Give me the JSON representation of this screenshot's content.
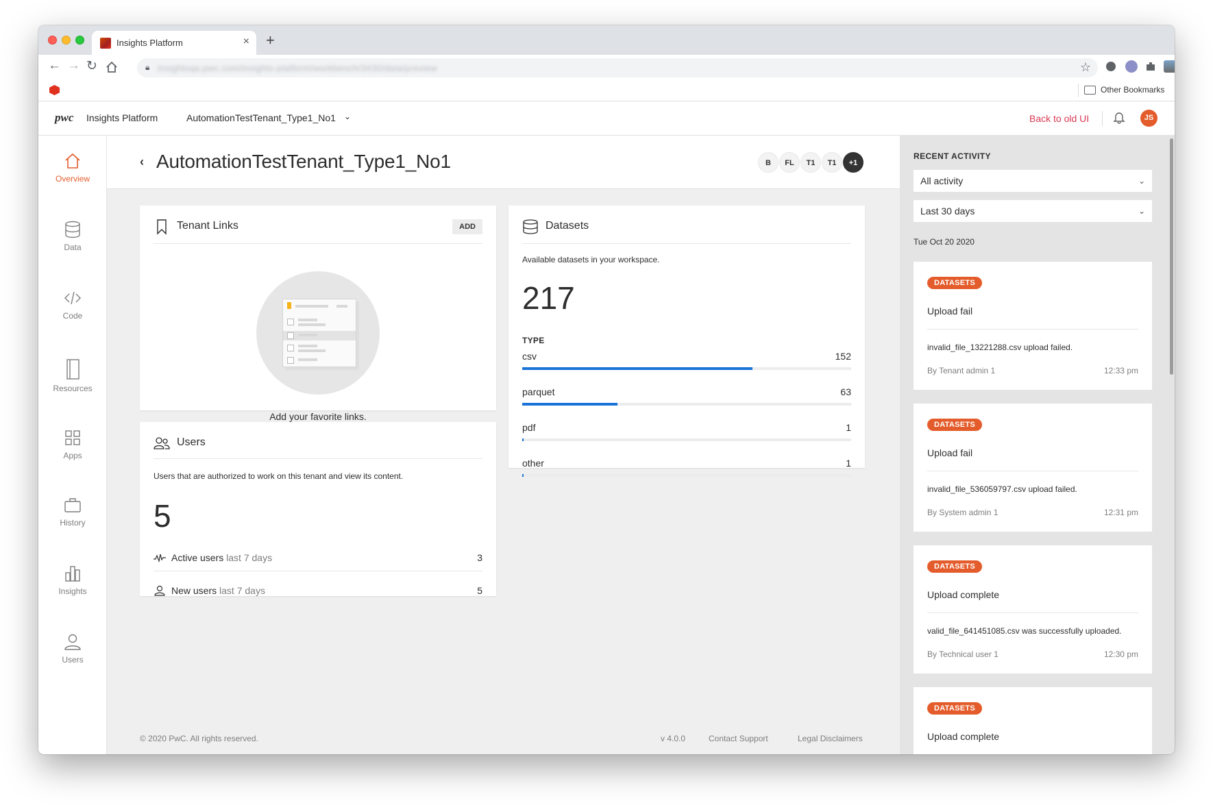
{
  "browser": {
    "tab_title": "Insights Platform",
    "url": "insightsqa.pwc.com/insights-platform/workbench/3430/data/preview",
    "bookmark_folder": "Other Bookmarks"
  },
  "header": {
    "logo": "pwc",
    "app_name": "Insights Platform",
    "tenant": "AutomationTestTenant_Type1_No1",
    "back_link": "Back to old UI",
    "avatar_initials": "JS"
  },
  "sidebar": {
    "items": [
      {
        "label": "Overview",
        "icon": "home-icon",
        "active": true
      },
      {
        "label": "Data",
        "icon": "database-icon"
      },
      {
        "label": "Code",
        "icon": "code-icon"
      },
      {
        "label": "Resources",
        "icon": "book-icon"
      },
      {
        "label": "Apps",
        "icon": "apps-grid-icon"
      },
      {
        "label": "History",
        "icon": "briefcase-icon"
      },
      {
        "label": "Insights",
        "icon": "bar-chart-icon"
      },
      {
        "label": "Users",
        "icon": "user-icon"
      }
    ]
  },
  "main": {
    "title": "AutomationTestTenant_Type1_No1",
    "chips": [
      "B",
      "FL",
      "T1",
      "T1",
      "+1"
    ],
    "tenant_links": {
      "title": "Tenant Links",
      "add_label": "ADD",
      "empty_text": "Add your favorite links."
    },
    "users": {
      "title": "Users",
      "description": "Users that are authorized to work on this tenant and view its content.",
      "count": "5",
      "rows": [
        {
          "label": "Active users",
          "sub": "last 7 days",
          "value": "3"
        },
        {
          "label": "New users",
          "sub": "last 7 days",
          "value": "5"
        }
      ]
    },
    "datasets": {
      "title": "Datasets",
      "description": "Available datasets in your workspace.",
      "count": "217",
      "type_label": "TYPE",
      "types": [
        {
          "name": "csv",
          "count": "152",
          "fraction": 0.7
        },
        {
          "name": "parquet",
          "count": "63",
          "fraction": 0.29
        },
        {
          "name": "pdf",
          "count": "1",
          "fraction": 0.005
        },
        {
          "name": "other",
          "count": "1",
          "fraction": 0.005
        }
      ]
    },
    "footer": {
      "copyright": "© 2020 PwC. All rights reserved.",
      "version": "v 4.0.0",
      "contact": "Contact Support",
      "legal": "Legal Disclaimers"
    }
  },
  "activity": {
    "title": "RECENT ACTIVITY",
    "filter": "All activity",
    "range": "Last 30 days",
    "date": "Tue Oct 20 2020",
    "items": [
      {
        "badge": "DATASETS",
        "title": "Upload fail",
        "message": "invalid_file_13221288.csv upload failed.",
        "by": "By Tenant admin 1",
        "time": "12:33 pm"
      },
      {
        "badge": "DATASETS",
        "title": "Upload fail",
        "message": "invalid_file_536059797.csv upload failed.",
        "by": "By System admin 1",
        "time": "12:31 pm"
      },
      {
        "badge": "DATASETS",
        "title": "Upload complete",
        "message": "valid_file_641451085.csv was successfully uploaded.",
        "by": "By Technical user 1",
        "time": "12:30 pm"
      },
      {
        "badge": "DATASETS",
        "title": "Upload complete",
        "message": "",
        "by": "",
        "time": ""
      }
    ]
  },
  "colors": {
    "accent": "#e45c2b",
    "link_red": "#d93954",
    "progress_blue": "#1a73d8"
  }
}
